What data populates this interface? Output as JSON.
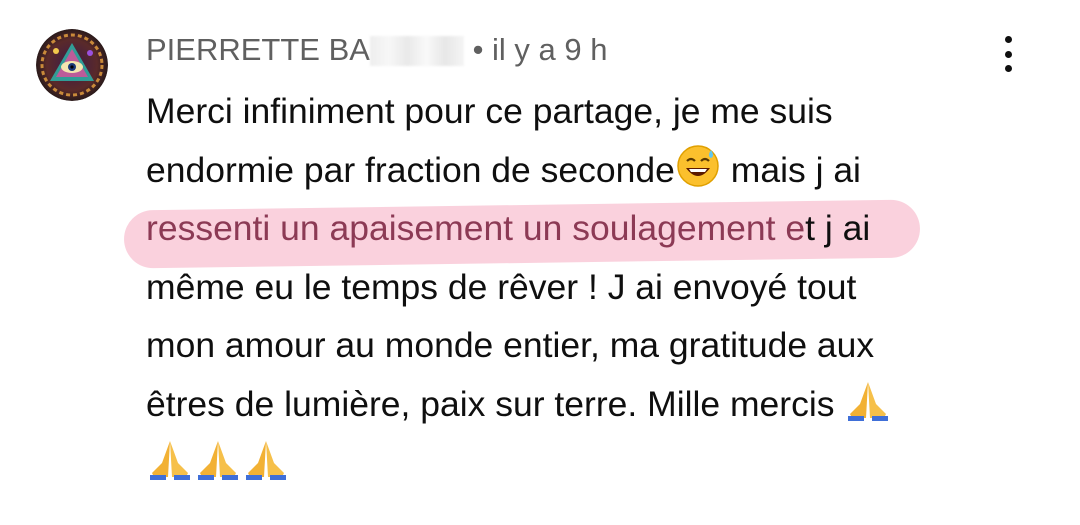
{
  "comment": {
    "author": "PIERRETTE BA",
    "separator": "•",
    "timestamp": "il y a 9 h",
    "lines": {
      "l1": "Merci infiniment pour ce partage, je me suis",
      "l2a": "endormie par fraction de seconde",
      "l2b": " mais j ai",
      "l3a": "ressenti un apaisement un soulagement e",
      "l3b": "t j ai",
      "l4": "même eu le temps de rêver ! J ai envoyé tout",
      "l5": "mon amour au monde entier, ma gratitude aux",
      "l6": "êtres de lumière, paix sur terre. Mille mercis "
    }
  },
  "icons": {
    "avatar": "psychedelic-eye-avatar",
    "menu": "more-vertical-icon",
    "emoji1": "grinning-face-with-sweat-emoji",
    "emoji2": "folded-hands-emoji"
  },
  "colors": {
    "highlight": "#f9c9d7",
    "meta_text": "#606060",
    "body_text": "#0f0f0f"
  }
}
